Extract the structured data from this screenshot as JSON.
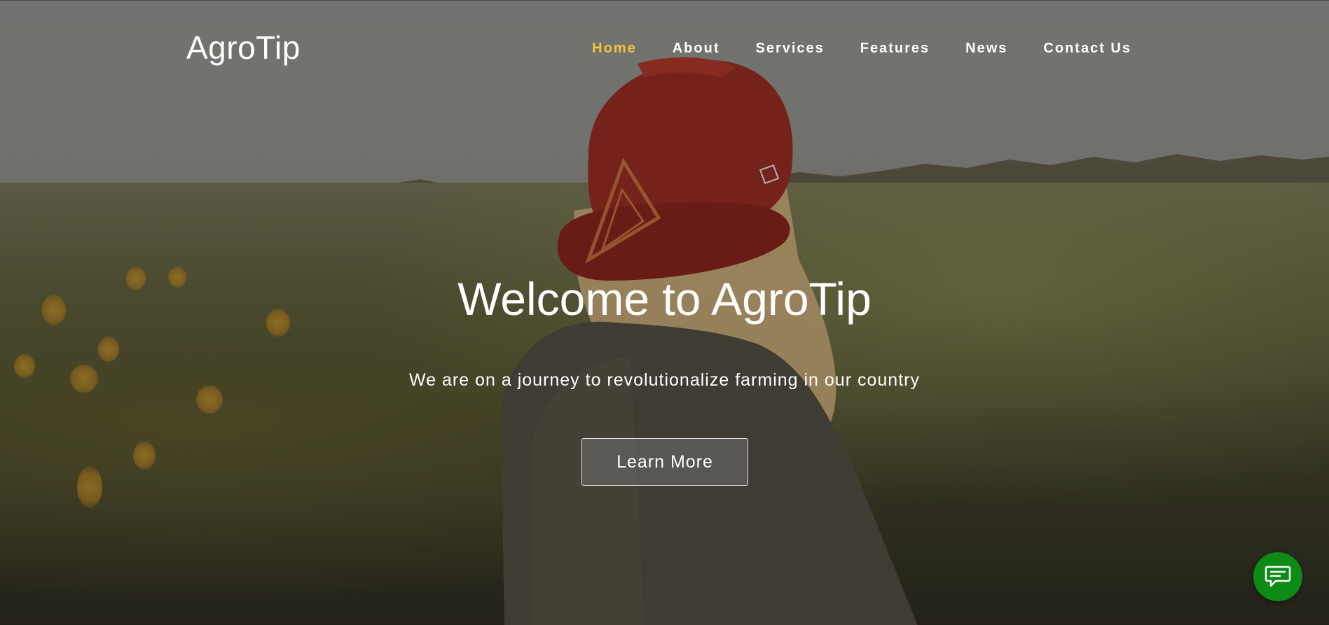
{
  "brand": {
    "logo_text": "AgroTip"
  },
  "nav": {
    "items": [
      {
        "label": "Home",
        "active": true
      },
      {
        "label": "About",
        "active": false
      },
      {
        "label": "Services",
        "active": false
      },
      {
        "label": "Features",
        "active": false
      },
      {
        "label": "News",
        "active": false
      },
      {
        "label": "Contact Us",
        "active": false
      }
    ],
    "active_color": "#f5c73a"
  },
  "hero": {
    "headline": "Welcome to AgroTip",
    "subheadline": "We are on a journey to revolutionalize farming in our country",
    "cta_label": "Learn More",
    "background_subject": "farm-field-person-red-cap"
  },
  "chat": {
    "icon": "chat-bubble-icon",
    "color": "#0e8a17"
  }
}
